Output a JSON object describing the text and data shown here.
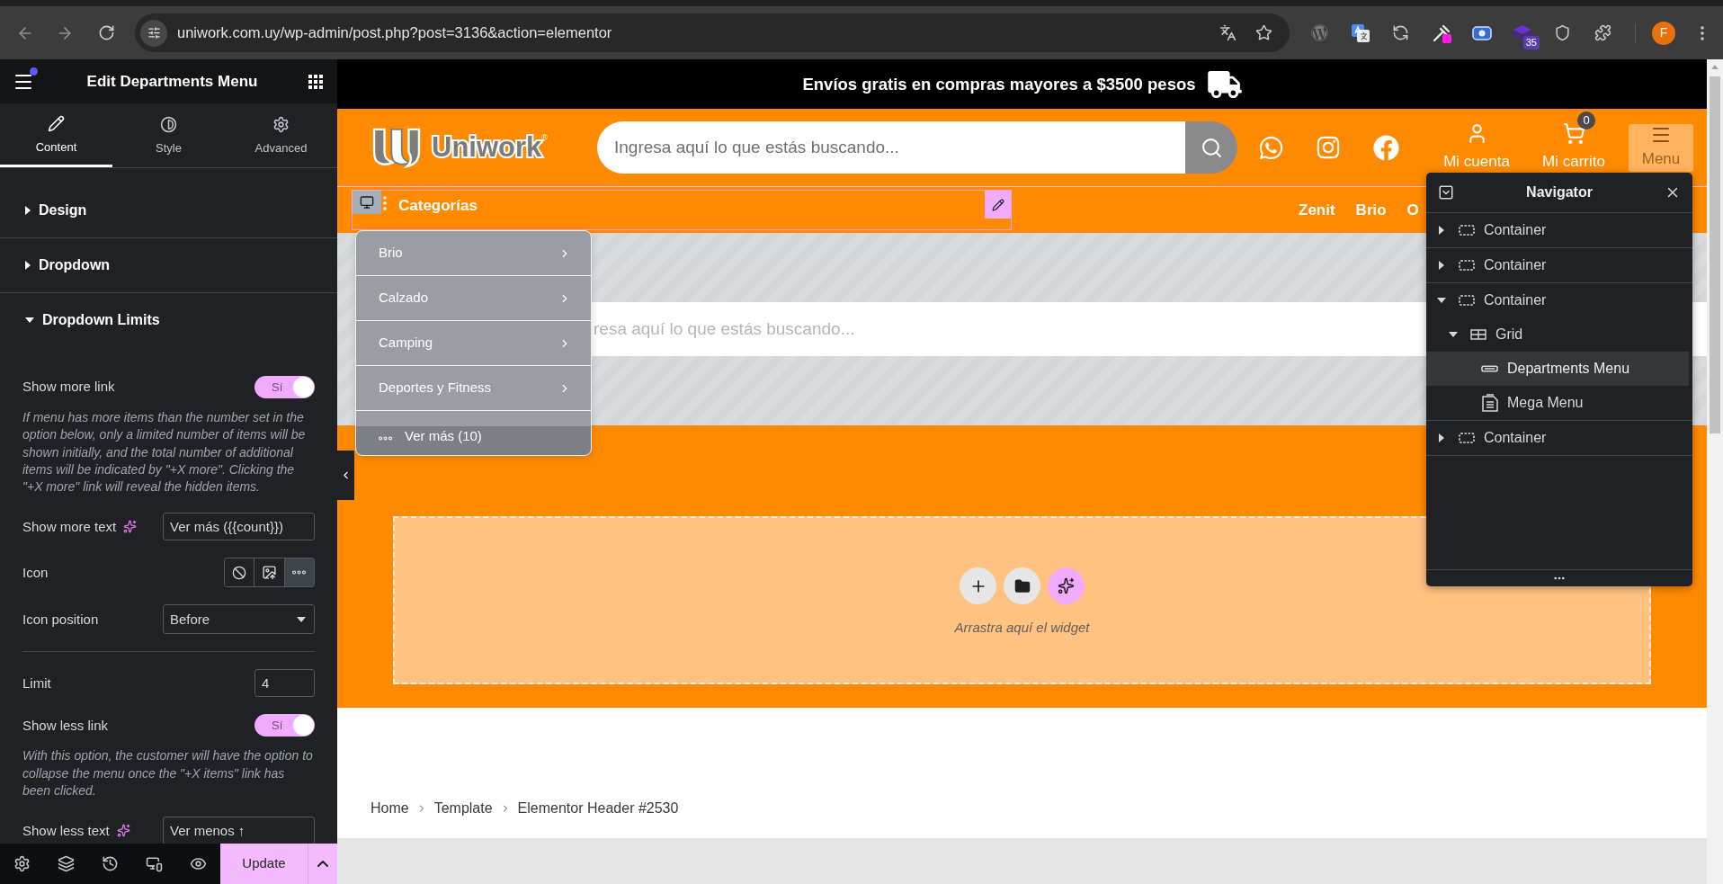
{
  "browser": {
    "url": "uniwork.com.uy/wp-admin/post.php?post=3136&action=elementor",
    "extension_badge": "35",
    "profile_initial": "F"
  },
  "panel": {
    "title": "Edit Departments Menu",
    "tabs": [
      {
        "label": "Content",
        "kind": "content",
        "selected": true
      },
      {
        "label": "Style",
        "kind": "style",
        "selected": false
      },
      {
        "label": "Advanced",
        "kind": "advanced",
        "selected": false
      }
    ],
    "sections": [
      {
        "label": "Design",
        "expanded": false
      },
      {
        "label": "Dropdown",
        "expanded": false
      },
      {
        "label": "Dropdown Limits",
        "expanded": true,
        "controls": [
          {
            "kind": "toggle",
            "label": "Show more link",
            "on": true,
            "on_text": "Sí",
            "description": "If menu has more items than the number set in the option below, only a limited number of items will be shown initially, and the total number of additional items will be indicated by \"+X more\". Clicking the \"+X more\" link will reveal the hidden items."
          },
          {
            "kind": "text",
            "label": "Show more text",
            "ai": true,
            "value": "Ver más ({{count}})"
          },
          {
            "kind": "choose",
            "label": "Icon",
            "options": [
              {
                "kind": "none",
                "selected": false
              },
              {
                "kind": "upload",
                "selected": false
              },
              {
                "kind": "dots",
                "selected": true
              }
            ]
          },
          {
            "kind": "select",
            "label": "Icon position",
            "value": "Before"
          },
          {
            "kind": "divider"
          },
          {
            "kind": "number",
            "label": "Limit",
            "value": "4"
          },
          {
            "kind": "toggle",
            "label": "Show less link",
            "on": true,
            "on_text": "Sí",
            "description": "With this option, the customer will have the option to collapse the menu once the \"+X items\" link has been clicked."
          },
          {
            "kind": "text",
            "label": "Show less text",
            "ai": true,
            "value": "Ver menos ↑"
          }
        ]
      }
    ],
    "update_label": "Update"
  },
  "site": {
    "banner": "Envíos gratis en compras mayores a $3500 pesos",
    "logo": {
      "text": "Uniwork",
      "mark": "®"
    },
    "search": {
      "placeholder": "Ingresa aquí lo que estás buscando..."
    },
    "account": {
      "label": "Mi cuenta"
    },
    "cart": {
      "label": "Mi carrito",
      "count": "0"
    },
    "menu_button": {
      "label": "Menu"
    },
    "departments": {
      "title": "Categorías",
      "items": [
        {
          "label": "Brio"
        },
        {
          "label": "Calzado"
        },
        {
          "label": "Camping"
        },
        {
          "label": "Deportes y Fitness"
        }
      ],
      "more": "Ver más (10)"
    },
    "nav_links": [
      "Zenit",
      "Brio",
      "O"
    ],
    "search_preview": {
      "placeholder": "resa aquí lo que estás buscando..."
    },
    "dropzone": {
      "caption": "Arrastra aquí el widget"
    },
    "breadcrumb": [
      "Home",
      "Template",
      "Elementor Header #2530"
    ]
  },
  "navigator": {
    "title": "Navigator",
    "tree": [
      {
        "label": "Container",
        "kind": "container",
        "expanded": false,
        "selected": false
      },
      {
        "label": "Container",
        "kind": "container",
        "expanded": false,
        "selected": false
      },
      {
        "label": "Container",
        "kind": "container",
        "expanded": true,
        "selected": false,
        "children": [
          {
            "label": "Grid",
            "kind": "grid",
            "expanded": true,
            "selected": false,
            "children": [
              {
                "label": "Departments Menu",
                "kind": "menu",
                "selected": true
              },
              {
                "label": "Mega Menu",
                "kind": "mega_menu",
                "selected": false
              }
            ]
          }
        ]
      },
      {
        "label": "Container",
        "kind": "container",
        "expanded": false,
        "selected": false
      }
    ]
  }
}
